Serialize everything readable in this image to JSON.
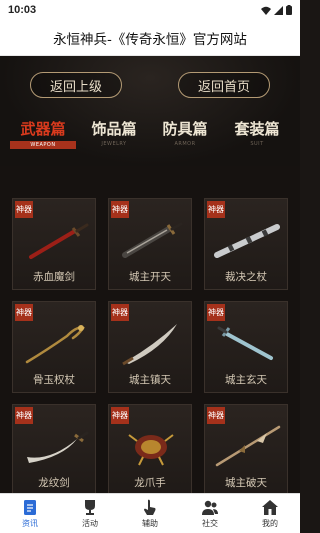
{
  "status": {
    "time": "10:03"
  },
  "title": "永恒神兵-《传奇永恒》官方网站",
  "buttons": {
    "back_up": "返回上级",
    "back_home": "返回首页"
  },
  "tabs": [
    {
      "zh": "武器篇",
      "en": "WEAPON",
      "active": true
    },
    {
      "zh": "饰品篇",
      "en": "JEWELRY"
    },
    {
      "zh": "防具篇",
      "en": "ARMOR"
    },
    {
      "zh": "套装篇",
      "en": "SUIT"
    }
  ],
  "badge": "神器",
  "weapons": [
    {
      "name": "赤血魔剑",
      "icon": "red-sword-icon"
    },
    {
      "name": "城主开天",
      "icon": "dark-sword-icon"
    },
    {
      "name": "裁决之杖",
      "icon": "silver-staff-icon"
    },
    {
      "name": "骨玉权杖",
      "icon": "bone-scepter-icon"
    },
    {
      "name": "城主镇天",
      "icon": "curved-blade-icon"
    },
    {
      "name": "城主玄天",
      "icon": "blue-sword-icon"
    },
    {
      "name": "龙纹剑",
      "icon": "dragon-sword-icon"
    },
    {
      "name": "龙爪手",
      "icon": "dragon-claw-icon"
    },
    {
      "name": "城主破天",
      "icon": "spear-icon"
    }
  ],
  "nav": [
    {
      "label": "资讯",
      "icon": "news-icon",
      "active": true
    },
    {
      "label": "活动",
      "icon": "trophy-icon"
    },
    {
      "label": "辅助",
      "icon": "hand-icon"
    },
    {
      "label": "社交",
      "icon": "people-icon"
    },
    {
      "label": "我的",
      "icon": "home-icon"
    }
  ],
  "colors": {
    "accent": "#a5311b",
    "active_tab": "#d93a1d",
    "nav_active": "#2b6bd6",
    "bg": "#1a1614"
  }
}
